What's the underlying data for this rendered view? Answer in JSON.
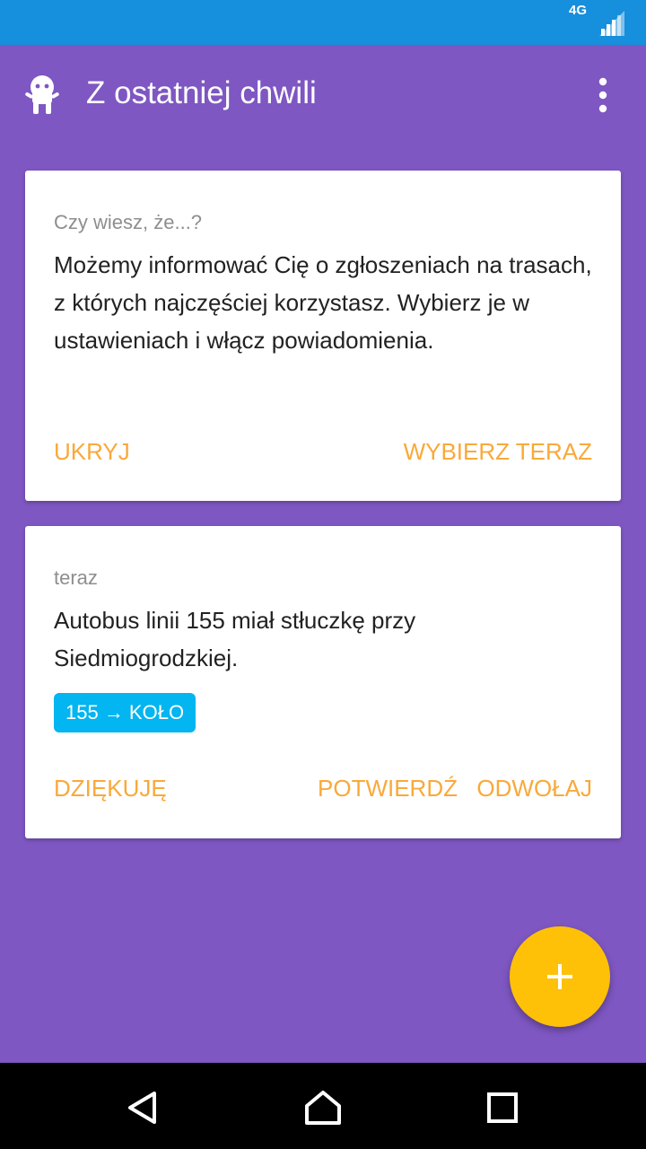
{
  "status_bar": {
    "network": "4G"
  },
  "app_bar": {
    "title": "Z ostatniej chwili"
  },
  "cards": [
    {
      "caption": "Czy wiesz, że...?",
      "body": "Możemy informować Cię o zgłoszeniach na trasach, z których najczęściej korzystasz. Wybierz je w ustawieniach i włącz powiadomienia.",
      "actions": {
        "hide": "UKRYJ",
        "choose_now": "WYBIERZ TERAZ"
      }
    },
    {
      "caption": "teraz",
      "body": "Autobus linii 155 miał stłuczkę przy Siedmiogrodzkiej.",
      "route_chip": "155 → KOŁO",
      "actions": {
        "thanks": "DZIĘKUJĘ",
        "confirm": "POTWIERDŹ",
        "cancel": "ODWOŁAJ"
      }
    }
  ],
  "fab": {
    "icon": "plus-icon"
  },
  "icons": {
    "app_logo": "ghost-mascot-icon",
    "overflow": "more-vert-icon",
    "signal": "cell-signal-icon",
    "back": "back-triangle-icon",
    "home": "home-icon",
    "recents": "recents-square-icon"
  },
  "colors": {
    "background": "#7e57c2",
    "status_bar": "#168fdc",
    "accent_action": "#f9a93a",
    "chip": "#03b5f0",
    "fab": "#ffc107"
  }
}
